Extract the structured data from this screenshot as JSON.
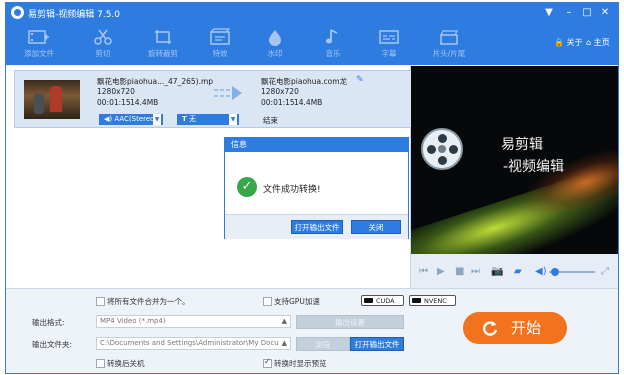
{
  "window": {
    "title": "易剪辑-视频编辑 7.5.0"
  },
  "toolbar": {
    "items": [
      {
        "label": "添加文件"
      },
      {
        "label": "剪切"
      },
      {
        "label": "旋转裁剪"
      },
      {
        "label": "特效"
      },
      {
        "label": "水印"
      },
      {
        "label": "音乐"
      },
      {
        "label": "字幕"
      },
      {
        "label": "片头/片尾"
      }
    ],
    "about_label": "关于",
    "home_label": "主页"
  },
  "file_row": {
    "source_name": "飘花电影piaohua..._47_265).mp",
    "source_resolution": "1280x720",
    "source_duration": "00:01:15",
    "source_size": "14.4MB",
    "output_name": "飘花电影piaohua.com龙",
    "output_resolution": "1280x720",
    "output_duration": "00:01:15",
    "output_size": "14.4MB",
    "audio_track": "AAC(Stereo 4",
    "subtitle": "无",
    "status": "结束"
  },
  "dialog": {
    "title": "信息",
    "message": "文件成功转换!",
    "open_folder_button": "打开输出文件",
    "close_button": "关闭"
  },
  "preview": {
    "title_line1": "易剪辑",
    "title_line2": "-视频编辑"
  },
  "bottom": {
    "merge_label": "将所有文件合并为一个。",
    "gpu_label": "支持GPU加速",
    "cuda_label": "CUDA",
    "nvenc_label": "NVENC",
    "format_label": "输出格式:",
    "format_value": "MP4 Video (*.mp4)",
    "output_settings_button": "输出设置",
    "folder_label": "输出文件夹:",
    "folder_value": "C:\\Documents and Settings\\Administrator\\My Docu",
    "browse_button": "浏览",
    "open_output_button": "打开输出文件",
    "shutdown_label": "转换后关机",
    "shutdown_checked": false,
    "preview_label": "转换时显示预览",
    "preview_checked": true,
    "start_button": "开始"
  },
  "colors": {
    "accent": "#2f7ce0",
    "start": "#f2721d",
    "success": "#36a84a"
  }
}
